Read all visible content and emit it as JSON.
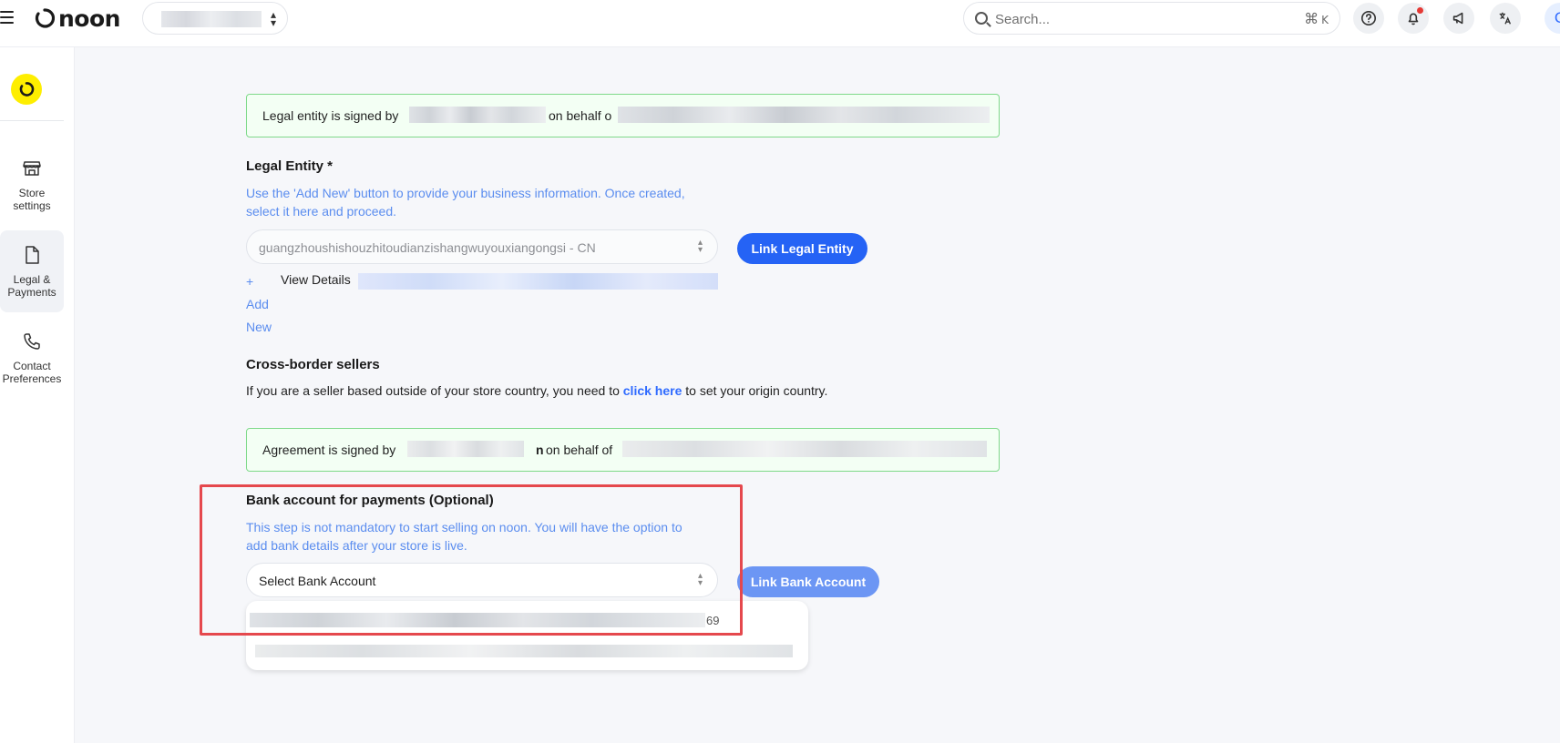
{
  "header": {
    "menu_icon": "hamburger-menu-icon",
    "logo_text": "noon",
    "search": {
      "placeholder": "Search...",
      "shortcut_symbol": "⌘",
      "shortcut_key": "K"
    },
    "avatar_letter": "C",
    "accent_color": "#2f6bff"
  },
  "sidebar": {
    "items": [
      {
        "label_line1": "Store",
        "label_line2": "settings",
        "icon": "store-icon"
      },
      {
        "label_line1": "Legal &",
        "label_line2": "Payments",
        "icon": "document-icon"
      },
      {
        "label_line1": "Contact",
        "label_line2": "Preferences",
        "icon": "phone-icon"
      }
    ]
  },
  "legal_banner": {
    "prefix": "Legal entity is signed by",
    "middle": "on behalf o"
  },
  "legal_entity": {
    "title": "Legal Entity *",
    "helper_line1": "Use the 'Add New' button to provide your business information. Once created,",
    "helper_line2": "select it here and proceed.",
    "selected_value": "guangzhoushishouzhitoudianzishangwuyouxiangongsi - CN",
    "link_button": "Link Legal Entity",
    "add_plus": "+",
    "add_label_1": "Add",
    "add_label_2": "New",
    "view_details": "View Details"
  },
  "cross_border": {
    "title": "Cross-border sellers",
    "text_before": "If you are a seller based outside of your store country, you need to",
    "link": "click here",
    "text_after": "to set your origin country."
  },
  "agreement_banner": {
    "prefix": "Agreement is signed by",
    "name_end": "n",
    "middle": "on behalf of"
  },
  "bank": {
    "title": "Bank account for payments (Optional)",
    "helper_line1": "This step is not mandatory to start selling on noon. You will have the option to",
    "helper_line2": "add bank details after your store is live.",
    "select_placeholder": "Select Bank Account",
    "link_button": "Link Bank Account",
    "dropdown_item1_end": "69"
  }
}
